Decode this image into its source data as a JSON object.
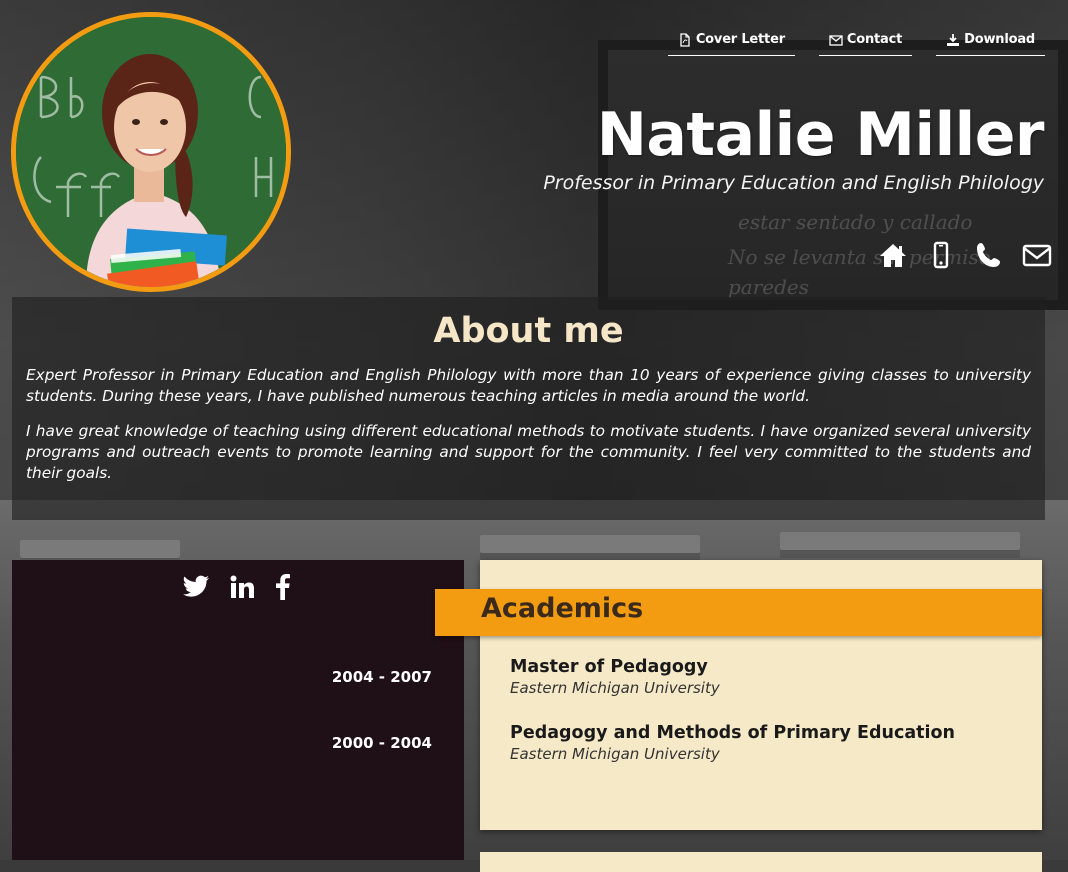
{
  "nav": {
    "cover_letter": "Cover Letter",
    "contact": "Contact",
    "download": "Download"
  },
  "profile": {
    "name": "Natalie Miller",
    "title": "Professor in Primary Education and English Philology"
  },
  "contact_icons": [
    "home-icon",
    "mobile-icon",
    "phone-icon",
    "envelope-icon"
  ],
  "about": {
    "heading": "About me",
    "paragraphs": [
      "Expert Professor in Primary Education and English Philology with more than 10 years of experience giving classes to university students. During these years, I have published numerous teaching articles in media around the world.",
      "I have great knowledge of teaching using different educational methods  to motivate  students.  I have organized several university programs and outreach events  to promote learning and support for the community. I feel very committed to the students and their goals."
    ]
  },
  "social": [
    "twitter-icon",
    "linkedin-icon",
    "facebook-icon"
  ],
  "academics": {
    "heading": "Academics",
    "entries": [
      {
        "years": "2004 - 2007",
        "degree": "Master of Pedagogy",
        "school": "Eastern Michigan University"
      },
      {
        "years": "2000 - 2004",
        "degree": "Pedagogy and Methods of Primary Education",
        "school": "Eastern Michigan University"
      }
    ]
  },
  "colors": {
    "accent": "#f39c12",
    "card": "#f6e9c8",
    "side_panel": "#1f0f16"
  }
}
